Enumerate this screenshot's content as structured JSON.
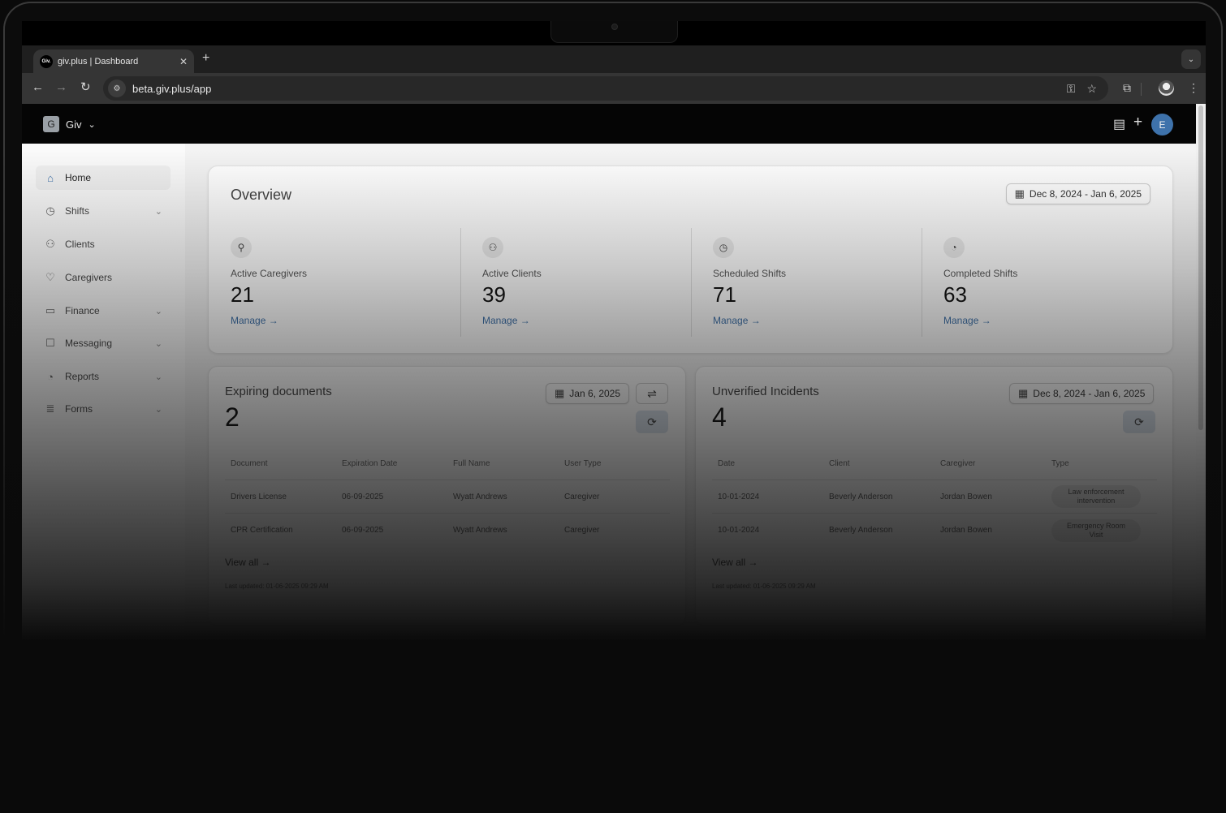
{
  "browser": {
    "tab_title": "giv.plus | Dashboard",
    "favicon_text": "Giv.",
    "tab_close": "✕",
    "new_tab": "+",
    "tab_list": "⌄",
    "url": "beta.giv.plus/app",
    "icons": {
      "back": "←",
      "forward": "→",
      "reload": "↻",
      "site_info": "⚙",
      "password_key": "⚿",
      "bookmark_star": "☆",
      "extensions": "⧉",
      "menu": "⋮"
    }
  },
  "header": {
    "org_logo": "G",
    "org_name": "Giv",
    "org_chevron": "⌄",
    "chat_icon": "▤",
    "add_icon": "+",
    "avatar_initial": "E"
  },
  "sidebar": {
    "items": [
      {
        "label": "Home",
        "icon": "⌂",
        "active": true,
        "expandable": false
      },
      {
        "label": "Shifts",
        "icon": "◷",
        "active": false,
        "expandable": true
      },
      {
        "label": "Clients",
        "icon": "⚇",
        "active": false,
        "expandable": false
      },
      {
        "label": "Caregivers",
        "icon": "♡",
        "active": false,
        "expandable": false
      },
      {
        "label": "Finance",
        "icon": "▭",
        "active": false,
        "expandable": true
      },
      {
        "label": "Messaging",
        "icon": "☐",
        "active": false,
        "expandable": true
      },
      {
        "label": "Reports",
        "icon": "◔",
        "active": false,
        "expandable": true
      },
      {
        "label": "Forms",
        "icon": "≣",
        "active": false,
        "expandable": true
      }
    ],
    "chevron": "⌄"
  },
  "overview": {
    "title": "Overview",
    "date_range": "Dec 8, 2024 - Jan 6, 2025",
    "calendar_icon": "▦",
    "stats": [
      {
        "label": "Active Caregivers",
        "value": "21",
        "link": "Manage →",
        "icon": "⚲"
      },
      {
        "label": "Active Clients",
        "value": "39",
        "link": "Manage →",
        "icon": "⚇"
      },
      {
        "label": "Scheduled Shifts",
        "value": "71",
        "link": "Manage →",
        "icon": "◷"
      },
      {
        "label": "Completed Shifts",
        "value": "63",
        "link": "Manage →",
        "icon": "◔"
      }
    ]
  },
  "expiring_documents": {
    "title": "Expiring documents",
    "count": "2",
    "date": "Jan 6, 2025",
    "filter_icon": "⇌",
    "refresh_icon": "⟳",
    "columns": [
      "Document",
      "Expiration Date",
      "Full Name",
      "User Type"
    ],
    "rows": [
      [
        "Drivers License",
        "06-09-2025",
        "Wyatt Andrews",
        "Caregiver"
      ],
      [
        "CPR Certification",
        "06-09-2025",
        "Wyatt Andrews",
        "Caregiver"
      ]
    ],
    "view_all": "View all →",
    "last_updated": "Last updated: 01-06-2025 09:29 AM"
  },
  "unverified_incidents": {
    "title": "Unverified Incidents",
    "count": "4",
    "date_range": "Dec 8, 2024 - Jan 6, 2025",
    "refresh_icon": "⟳",
    "columns": [
      "Date",
      "Client",
      "Caregiver",
      "Type"
    ],
    "rows": [
      [
        "10-01-2024",
        "Beverly Anderson",
        "Jordan Bowen",
        "Law enforcement intervention"
      ],
      [
        "10-01-2024",
        "Beverly Anderson",
        "Jordan Bowen",
        "Emergency Room Visit"
      ]
    ],
    "view_all": "View all →",
    "last_updated": "Last updated: 01-06-2025 09:29 AM"
  },
  "colors": {
    "accent": "#3e72ab",
    "header_bg": "#050505",
    "browser_toolbar": "#353535"
  }
}
